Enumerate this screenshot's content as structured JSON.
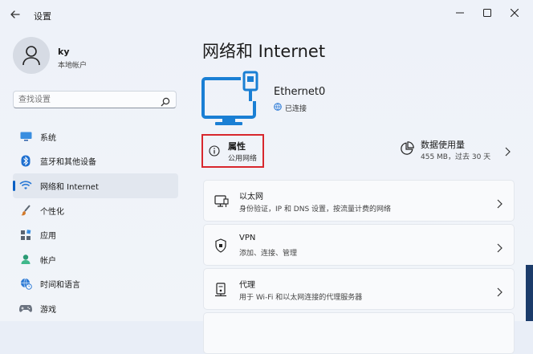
{
  "window": {
    "title": "设置",
    "icons": {
      "back": "back-arrow-icon",
      "minimize": "minimize-icon",
      "maximize": "maximize-icon",
      "close": "close-icon"
    }
  },
  "user": {
    "name": "ky",
    "account_type": "本地帐户"
  },
  "search": {
    "placeholder": "查找设置"
  },
  "sidebar": {
    "items": [
      {
        "label": "系统",
        "icon": "system-display-icon",
        "color": "#3a78c9"
      },
      {
        "label": "蓝牙和其他设备",
        "icon": "bluetooth-icon",
        "color": "#1e6fd0"
      },
      {
        "label": "网络和 Internet",
        "icon": "wifi-icon",
        "color": "#2878d6",
        "active": true
      },
      {
        "label": "个性化",
        "icon": "brush-icon",
        "color": "#d27a2c"
      },
      {
        "label": "应用",
        "icon": "apps-icon",
        "color": "#5a6472"
      },
      {
        "label": "帐户",
        "icon": "account-icon",
        "color": "#2a9a74"
      },
      {
        "label": "时间和语言",
        "icon": "globe-clock-icon",
        "color": "#2d7ad5"
      },
      {
        "label": "游戏",
        "icon": "gamepad-icon",
        "color": "#6b7380"
      }
    ]
  },
  "main": {
    "page_title": "网络和 Internet",
    "ethernet": {
      "name": "Ethernet0",
      "status": "已连接"
    },
    "properties": {
      "title": "属性",
      "subtitle": "公用网络"
    },
    "data_usage": {
      "title": "数据使用量",
      "subtitle": "455 MB，过去 30 天"
    },
    "cards": [
      {
        "title": "以太网",
        "subtitle": "身份验证，IP 和 DNS 设置，按流量计费的网络",
        "icon": "ethernet-icon"
      },
      {
        "title": "VPN",
        "subtitle": "添加、连接、管理",
        "icon": "shield-icon"
      },
      {
        "title": "代理",
        "subtitle": "用于 Wi-Fi 和以太网连接的代理服务器",
        "icon": "proxy-icon"
      }
    ]
  },
  "colors": {
    "accent": "#0a5fc4",
    "highlight_border": "#d8272d",
    "monitor_blue": "#1a7fd4"
  }
}
